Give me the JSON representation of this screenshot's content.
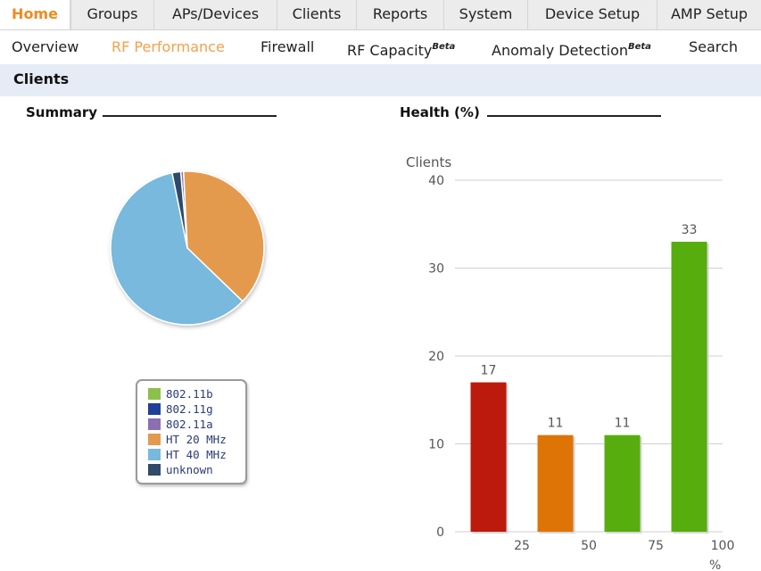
{
  "top_tabs": [
    {
      "label": "Home",
      "active": true
    },
    {
      "label": "Groups"
    },
    {
      "label": "APs/Devices"
    },
    {
      "label": "Clients"
    },
    {
      "label": "Reports"
    },
    {
      "label": "System"
    },
    {
      "label": "Device Setup"
    },
    {
      "label": "AMP Setup"
    }
  ],
  "sub_tabs": [
    {
      "label": "Overview"
    },
    {
      "label": "RF Performance",
      "active": true
    },
    {
      "label": "Firewall"
    },
    {
      "label": "RF Capacity",
      "beta": "Beta"
    },
    {
      "label": "Anomaly Detection",
      "beta": "Beta"
    },
    {
      "label": "Search"
    }
  ],
  "section": {
    "title": "Clients"
  },
  "summary_panel": {
    "title": "Summary",
    "pie": [
      {
        "label": "802.11b",
        "value": 0,
        "color": "#8cc04b"
      },
      {
        "label": "802.11g",
        "value": 0,
        "color": "#1f3f99"
      },
      {
        "label": "802.11a",
        "value": 0.6,
        "color": "#8b6fb3"
      },
      {
        "label": "HT 20 MHz",
        "value": 38,
        "color": "#e49a4e"
      },
      {
        "label": "HT 40 MHz",
        "value": 59.6,
        "color": "#78b9dd"
      },
      {
        "label": "unknown",
        "value": 1.8,
        "color": "#2f4a6a"
      }
    ]
  },
  "health_panel": {
    "title": "Health (%)"
  },
  "chart_data": {
    "type": "bar",
    "title": "Health (%)",
    "ylabel": "Clients",
    "xlabel": "%",
    "ylim": [
      0,
      40
    ],
    "y_ticks": [
      0,
      10,
      20,
      30,
      40
    ],
    "x_ticks": [
      "25",
      "50",
      "75",
      "100"
    ],
    "categories": [
      "0-25",
      "25-50",
      "50-75",
      "75-100"
    ],
    "values": [
      17,
      11,
      11,
      33
    ],
    "colors": [
      "#bb1a0c",
      "#df7406",
      "#58ad0e",
      "#58ad0e"
    ],
    "grid": true
  }
}
